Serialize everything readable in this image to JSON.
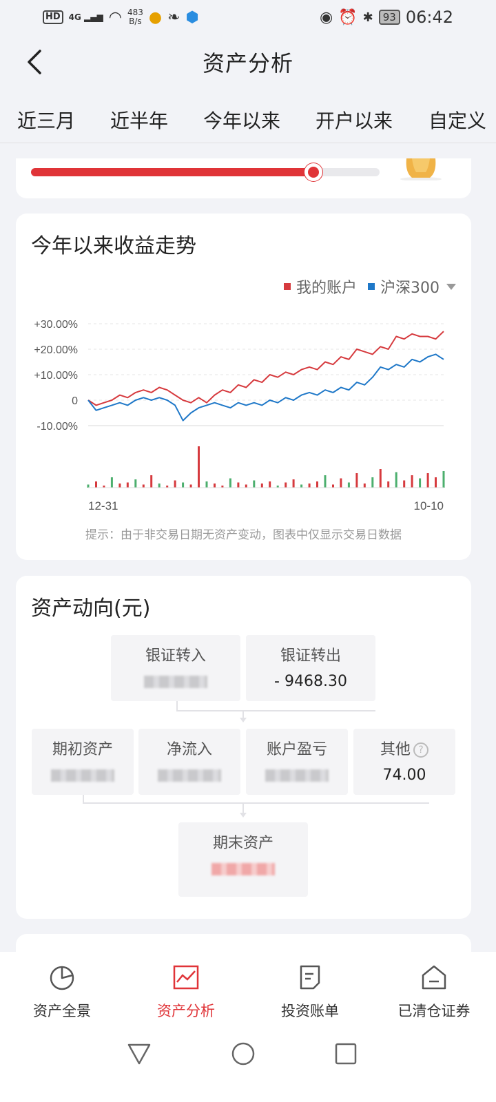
{
  "status_bar": {
    "hd": "HD",
    "signal": "4G",
    "net_speed_value": "483",
    "net_speed_unit": "B/s",
    "battery": "93",
    "time": "06:42"
  },
  "header": {
    "title": "资产分析"
  },
  "tabs": [
    {
      "label": "近三月",
      "active": false
    },
    {
      "label": "近半年",
      "active": false
    },
    {
      "label": "今年以来",
      "active": true
    },
    {
      "label": "开户以来",
      "active": false
    },
    {
      "label": "自定义",
      "active": false
    }
  ],
  "progress": {
    "value": 0.81
  },
  "trend": {
    "title": "今年以来收益走势",
    "legend": {
      "mine": "我的账户",
      "index": "沪深300"
    },
    "note": "提示：由于非交易日期无资产变动，图表中仅显示交易日数据"
  },
  "chart_data": {
    "type": "line",
    "title": "今年以来收益走势",
    "y_tick_labels": [
      "+30.00%",
      "+20.00%",
      "+10.00%",
      "0",
      "-10.00%"
    ],
    "ylim": [
      -10,
      30
    ],
    "x_tick_labels": [
      "12-31",
      "10-10"
    ],
    "colors": {
      "mine": "#d63a3e",
      "index": "#1f78c8"
    },
    "series": [
      {
        "name": "我的账户",
        "values": [
          0,
          -2,
          -1,
          0,
          2,
          1,
          3,
          4,
          3,
          5,
          4,
          2,
          0,
          -1,
          1,
          -1,
          2,
          4,
          3,
          6,
          5,
          8,
          7,
          10,
          9,
          11,
          10,
          12,
          13,
          12,
          15,
          14,
          17,
          16,
          20,
          19,
          18,
          21,
          20,
          25,
          24,
          26,
          25,
          25,
          24,
          27
        ]
      },
      {
        "name": "沪深300",
        "values": [
          0,
          -4,
          -3,
          -2,
          -1,
          -2,
          0,
          1,
          0,
          1,
          0,
          -2,
          -8,
          -5,
          -3,
          -2,
          -1,
          -2,
          -3,
          -1,
          -2,
          -1,
          -2,
          0,
          -1,
          1,
          0,
          2,
          3,
          2,
          4,
          3,
          5,
          4,
          7,
          6,
          9,
          13,
          12,
          14,
          13,
          16,
          15,
          17,
          18,
          16
        ]
      }
    ],
    "volume_scale": [
      3,
      6,
      2,
      10,
      4,
      5,
      8,
      3,
      12,
      4,
      2,
      7,
      5,
      3,
      40,
      6,
      4,
      2,
      9,
      5,
      3,
      7,
      4,
      6,
      2,
      5,
      8,
      3,
      4,
      6,
      12,
      3,
      9,
      5,
      14,
      4,
      10,
      18,
      6,
      15,
      7,
      12,
      9,
      14,
      10,
      16
    ]
  },
  "asset_flow": {
    "title": "资产动向(元)",
    "bank_in": {
      "label": "银证转入",
      "value": ""
    },
    "bank_out": {
      "label": "银证转出",
      "value": "- 9468.30"
    },
    "opening": {
      "label": "期初资产",
      "value": ""
    },
    "net_inflow": {
      "label": "净流入",
      "value": ""
    },
    "pnl": {
      "label": "账户盈亏",
      "value": ""
    },
    "other": {
      "label": "其他",
      "value": "74.00",
      "help": "?"
    },
    "closing": {
      "label": "期末资产",
      "value": ""
    }
  },
  "bottom_nav": [
    {
      "label": "资产全景",
      "icon": "pie-chart-icon",
      "active": false
    },
    {
      "label": "资产分析",
      "icon": "trend-chart-icon",
      "active": true
    },
    {
      "label": "投资账单",
      "icon": "bill-icon",
      "active": false
    },
    {
      "label": "已清仓证券",
      "icon": "cleared-house-icon",
      "active": false
    }
  ]
}
